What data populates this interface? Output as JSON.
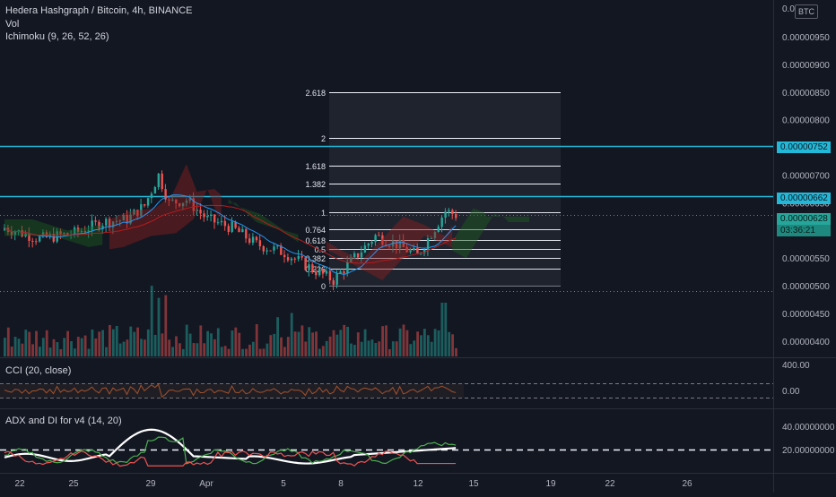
{
  "header": {
    "title": "Hedera Hashgraph / Bitcoin, 4h, BINANCE",
    "vol_label": "Vol",
    "ichimoku_label": "Ichimoku (9, 26, 52, 26)",
    "currency_badge": "BTC"
  },
  "price_axis": {
    "ticks": [
      "0.00000950",
      "0.00000900",
      "0.00000850",
      "0.00000800",
      "0.00000750",
      "0.00000700",
      "0.00000650",
      "0.00000600",
      "0.00000550",
      "0.00000500",
      "0.00000450",
      "0.00000400"
    ],
    "top_tick": "0.00",
    "tag_upper": "0.00000752",
    "tag_lower": "0.00000662",
    "tag_last": "0.00000628",
    "tag_countdown": "03:36:21",
    "colors": {
      "tag_cyan": "#22b8d8",
      "tag_green": "#26a69a"
    }
  },
  "time_axis": {
    "labels": [
      "22",
      "25",
      "29",
      "Apr",
      "5",
      "8",
      "12",
      "15",
      "19",
      "22",
      "26"
    ]
  },
  "fib": {
    "levels": [
      "0",
      "0.236",
      "0.382",
      "0.5",
      "0.618",
      "0.764",
      "1",
      "1.382",
      "1.618",
      "2",
      "2.618"
    ],
    "level_values": [
      5e-06,
      5.315e-06,
      5.511e-06,
      5.668e-06,
      5.826e-06,
      6.022e-06,
      6.336e-06,
      6.847e-06,
      7.162e-06,
      7.672e-06,
      8.499e-06
    ]
  },
  "cci": {
    "label": "CCI (20, close)",
    "ticks": [
      "400.00",
      "0.00"
    ]
  },
  "adx": {
    "label": "ADX and DI for v4 (14, 20)",
    "ticks": [
      "40.00000000",
      "20.00000000"
    ]
  },
  "chart_data": {
    "type": "candlestick",
    "symbol": "Hedera Hashgraph / Bitcoin",
    "timeframe": "4h",
    "exchange": "BINANCE",
    "y_range": [
      3.9e-06,
      1.01e-05
    ],
    "horizontal_lines": [
      7.52e-06,
      6.62e-06
    ],
    "last_price": 6.28e-06,
    "ichimoku": {
      "params": [
        9,
        26,
        52,
        26
      ]
    },
    "fib_retracement": {
      "low": 5e-06,
      "high": 6.336e-06
    },
    "cci": {
      "length": 20,
      "source": "close",
      "bands": [
        100,
        -100
      ]
    },
    "adx_di": {
      "params": [
        14,
        20
      ],
      "threshold": 20
    }
  }
}
